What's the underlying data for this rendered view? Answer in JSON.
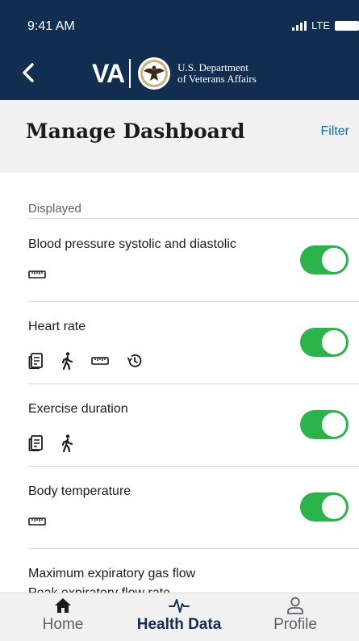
{
  "status": {
    "time": "9:41 AM",
    "network": "LTE"
  },
  "nav": {
    "logo_letters": "VA",
    "dept_line1": "U.S. Department",
    "dept_line2": "of Veterans Affairs"
  },
  "header": {
    "title": "Manage Dashboard",
    "filter_label": "Filter"
  },
  "section": {
    "label": "Displayed"
  },
  "rows": [
    {
      "title": "Blood pressure systolic and diastolic",
      "icons": [
        "ruler-icon"
      ],
      "enabled": true
    },
    {
      "title": "Heart rate",
      "icons": [
        "document-icon",
        "walking-icon",
        "ruler-icon",
        "history-icon"
      ],
      "enabled": true
    },
    {
      "title": "Exercise duration",
      "icons": [
        "document-icon",
        "walking-icon"
      ],
      "enabled": true
    },
    {
      "title": "Body temperature",
      "icons": [
        "ruler-icon"
      ],
      "enabled": true
    },
    {
      "title": "Maximum expiratory gas flow",
      "subtitle": "Peak expiratory flow rate",
      "icons": [],
      "enabled": true
    }
  ],
  "tabs": [
    {
      "label": "Home",
      "icon": "home-icon",
      "active": false
    },
    {
      "label": "Health Data",
      "icon": "heartbeat-icon",
      "active": true
    },
    {
      "label": "Profile",
      "icon": "person-icon",
      "active": false
    }
  ],
  "colors": {
    "navy": "#112e51",
    "toggle_on": "#2ab44a",
    "link": "#0071bb"
  }
}
